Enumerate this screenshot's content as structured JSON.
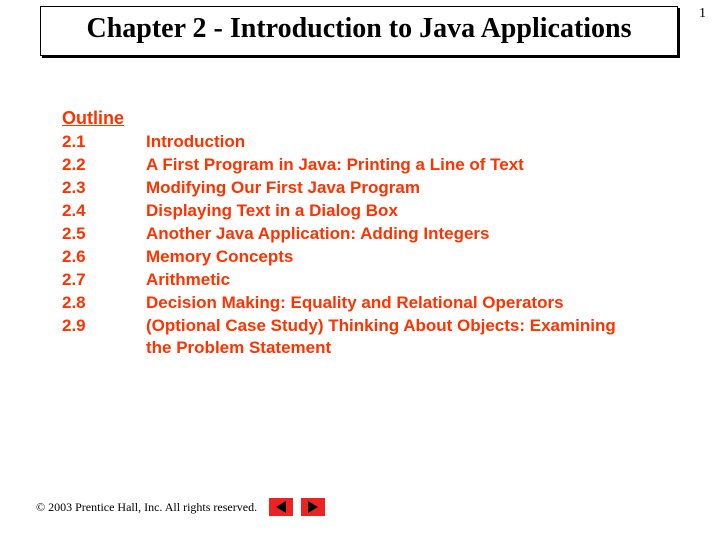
{
  "page_number": "1",
  "title": "Chapter 2 - Introduction to Java Applications",
  "outline": {
    "heading": "Outline",
    "items": [
      {
        "num": "2.1",
        "text": "Introduction"
      },
      {
        "num": "2.2",
        "text": "A First Program in Java: Printing a Line of Text"
      },
      {
        "num": "2.3",
        "text": "Modifying Our First Java Program"
      },
      {
        "num": "2.4",
        "text": "Displaying Text in a Dialog Box"
      },
      {
        "num": "2.5",
        "text": "Another Java Application: Adding Integers"
      },
      {
        "num": "2.6",
        "text": "Memory Concepts"
      },
      {
        "num": "2.7",
        "text": "Arithmetic"
      },
      {
        "num": "2.8",
        "text": "Decision Making: Equality and Relational Operators"
      },
      {
        "num": "2.9",
        "text": "(Optional Case Study) Thinking About Objects: Examining the Problem Statement"
      }
    ]
  },
  "footer": {
    "copyright": "© 2003 Prentice Hall, Inc.  All rights reserved."
  }
}
